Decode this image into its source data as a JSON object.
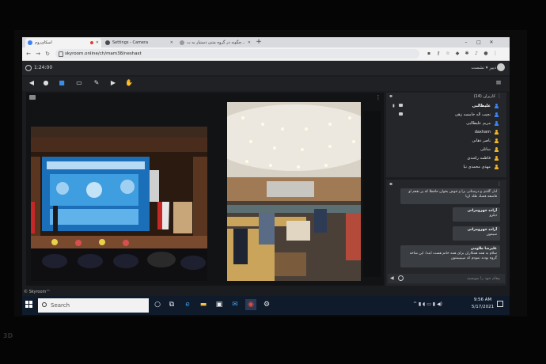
{
  "browser": {
    "tabs": [
      {
        "label": "اسکای‌روم",
        "recording": true
      },
      {
        "label": "Settings - Camera"
      },
      {
        "label": "چگونه در گروه متنی دستیار به ت..."
      }
    ],
    "new_tab": "+",
    "window_controls": [
      "–",
      "□",
      "✕"
    ],
    "nav": {
      "back": "←",
      "forward": "→",
      "reload": "↻"
    },
    "url": "skyroom.online/ch/mam38/neshast"
  },
  "skyroom": {
    "timer": "1:24:00",
    "user_label": "دبیر ▾ نشست",
    "video_more": "⋮",
    "users_panel": {
      "title": "کاربران (14)",
      "menu": "⋮",
      "users": [
        {
          "name": "علیطالبی",
          "bold": true,
          "icon_color": "blue",
          "mic": true,
          "cam": true
        },
        {
          "name": "نجیب اله خامسه زهی",
          "bold": false,
          "icon_color": "blue",
          "mic": false,
          "cam": true
        },
        {
          "name": "مریم علیطالبی",
          "bold": false,
          "icon_color": "blue",
          "mic": false,
          "cam": false
        },
        {
          "name": "daxham",
          "bold": false,
          "icon_color": "yellow",
          "mic": false,
          "cam": false
        },
        {
          "name": "ناصر دهانی",
          "bold": false,
          "icon_color": "yellow",
          "mic": false,
          "cam": false
        },
        {
          "name": "ساتلی",
          "bold": false,
          "icon_color": "yellow",
          "mic": false,
          "cam": false
        },
        {
          "name": "فاطمه راشدی",
          "bold": false,
          "icon_color": "yellow",
          "mic": false,
          "cam": false
        },
        {
          "name": "مهدی محمدی نیا",
          "bold": false,
          "icon_color": "yellow",
          "mic": false,
          "cam": false
        }
      ]
    },
    "chat_panel": {
      "menu": "⋮",
      "messages": [
        {
          "sender": "",
          "text": "ادل گلذی و درستانی برا و خوش بخوان حافظا که پر نفعم او فاسفه فشك طلد ازيا"
        },
        {
          "sender": "آزاده جهرومرانی",
          "text": "ذيلرو"
        },
        {
          "sender": "آزاده جهرومرانی",
          "text": "سیمون"
        },
        {
          "sender": "علیرضا طاومی",
          "text": "سلام به همه همکاران برای همه خانم هست ابتدا. این شاخه گروه بودند نمودم که میبینیمتون"
        }
      ],
      "input_placeholder": "پیغام خود را بنویسید"
    },
    "footer": "© Skyroom™"
  },
  "taskbar": {
    "search_placeholder": "Search",
    "time": "9:56 AM",
    "date": "5/17/2021"
  },
  "bezel": {
    "label": "3D"
  }
}
